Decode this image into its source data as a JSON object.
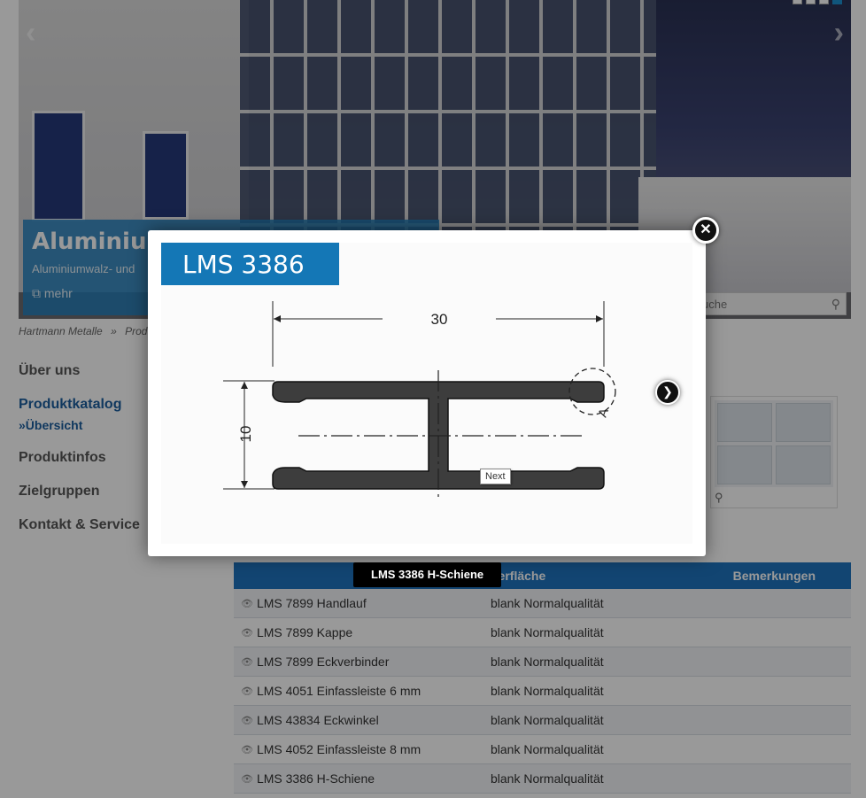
{
  "hero": {
    "caption_title": "Aluminium",
    "caption_sub": "Aluminiumwalz- und",
    "more_label": "mehr",
    "search_placeholder": "uche",
    "slide_count": 4,
    "active_slide": 4
  },
  "breadcrumb": [
    "Hartmann Metalle",
    "»",
    "Prod"
  ],
  "nav": {
    "items": [
      {
        "label": "Über uns"
      },
      {
        "label": "Produktkatalog",
        "active": true,
        "sub": "»Übersicht"
      },
      {
        "label": "Produktinfos"
      },
      {
        "label": "Zielgruppen"
      },
      {
        "label": "Kontakt & Service"
      }
    ]
  },
  "lightbox": {
    "title": "LMS 3386",
    "caption": "LMS 3386 H-Schiene",
    "tooltip": "Next",
    "drawing": {
      "width_label": "30",
      "height_label": "10",
      "detail_label": "A"
    }
  },
  "table": {
    "headers": [
      "",
      "berfläche",
      "Bemerkungen"
    ],
    "rows": [
      {
        "name": "LMS 7899 Handlauf",
        "surface": "blank Normalqualität"
      },
      {
        "name": "LMS 7899 Kappe",
        "surface": "blank Normalqualität"
      },
      {
        "name": "LMS 7899 Eckverbinder",
        "surface": "blank Normalqualität"
      },
      {
        "name": "LMS 4051 Einfassleiste 6 mm",
        "surface": "blank Normalqualität"
      },
      {
        "name": "LMS 43834 Eckwinkel",
        "surface": "blank Normalqualität"
      },
      {
        "name": "LMS 4052 Einfassleiste 8 mm",
        "surface": "blank Normalqualität"
      },
      {
        "name": "LMS 3386 H-Schiene",
        "surface": "blank Normalqualität"
      }
    ]
  },
  "icons": {
    "close": "close-icon",
    "next": "chevron-right-icon",
    "search": "search-icon",
    "zoom": "zoom-icon",
    "eye": "eye-icon"
  },
  "colors": {
    "accent": "#1477b6",
    "table_header": "#1e73be",
    "nav_active": "#1b5e9e"
  }
}
